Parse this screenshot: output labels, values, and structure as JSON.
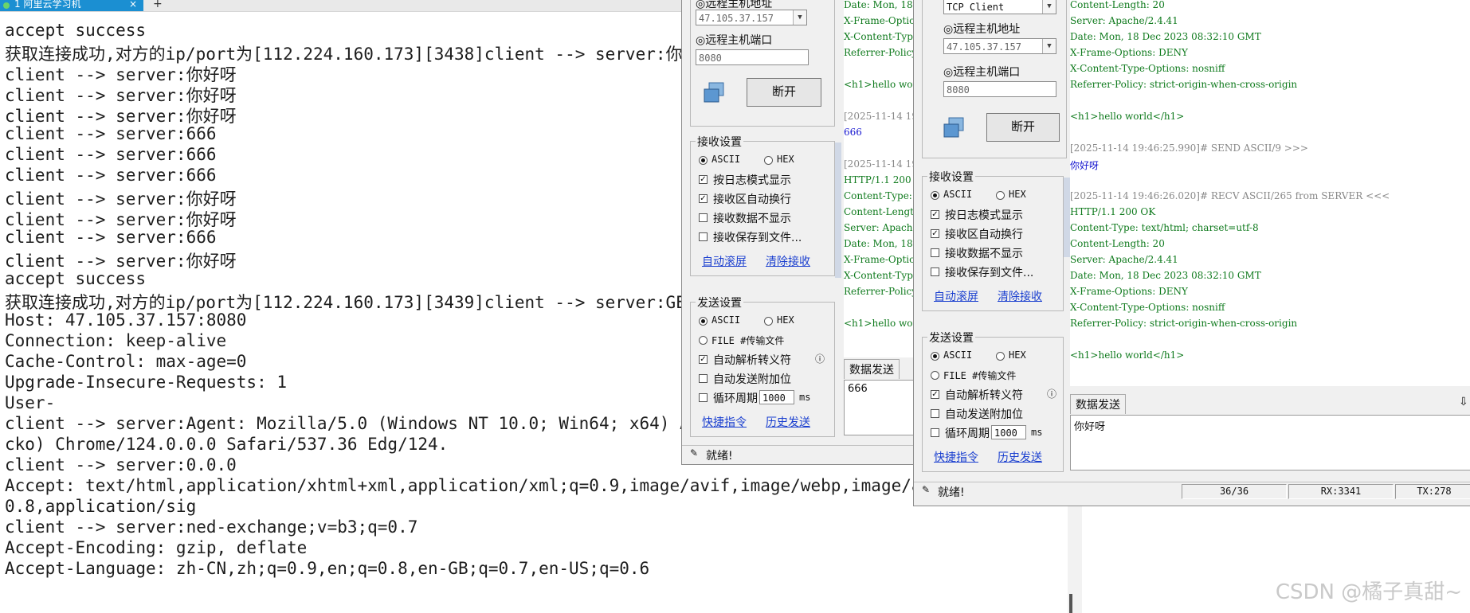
{
  "terminal": {
    "tab_label": "1 阿里云学习机",
    "close_glyph": "×",
    "new_tab_glyph": "+",
    "lines": [
      "accept success",
      "获取连接成功,对方的ip/port为[112.224.160.173][3438]client --> server:你好呀",
      "client --> server:你好呀",
      "client --> server:你好呀",
      "client --> server:你好呀",
      "client --> server:666",
      "client --> server:666",
      "client --> server:666",
      "client --> server:你好呀",
      "client --> server:你好呀",
      "client --> server:666",
      "client --> server:你好呀",
      "accept success",
      "获取连接成功,对方的ip/port为[112.224.160.173][3439]client --> server:GET / HTTP/1.1",
      "Host: 47.105.37.157:8080",
      "Connection: keep-alive",
      "Cache-Control: max-age=0",
      "Upgrade-Insecure-Requests: 1",
      "User-",
      "client --> server:Agent: Mozilla/5.0 (Windows NT 10.0; Win64; x64) AppleWebKit/537.36 (KHTML, like Ge",
      "cko) Chrome/124.0.0.0 Safari/537.36 Edg/124.",
      "client --> server:0.0.0",
      "Accept: text/html,application/xhtml+xml,application/xml;q=0.9,image/avif,image/webp,image/apng,*/*;q=",
      "0.8,application/sig",
      "client --> server:ned-exchange;v=b3;q=0.7",
      "Accept-Encoding: gzip, deflate",
      "Accept-Language: zh-CN,zh;q=0.9,en;q=0.8,en-GB;q=0.7,en-US;q=0.6"
    ]
  },
  "tool1": {
    "remote_host_label": "◎远程主机地址",
    "remote_host_value": "47.105.37.157",
    "remote_port_label": "◎远程主机端口",
    "remote_port_value": "8080",
    "disconnect_label": "断开",
    "recv_group_title": "接收设置",
    "recv_ascii": "ASCII",
    "recv_hex": "HEX",
    "opt_log_mode": "按日志模式显示",
    "opt_auto_wrap": "接收区自动换行",
    "opt_hide_data": "接收数据不显示",
    "opt_save_file": "接收保存到文件...",
    "link_auto_scroll": "自动滚屏",
    "link_clear_recv": "清除接收",
    "send_group_title": "发送设置",
    "send_ascii": "ASCII",
    "send_hex": "HEX",
    "send_file": "FILE #传输文件",
    "opt_escape": "自动解析转义符",
    "opt_append": "自动发送附加位",
    "opt_cycle": "循环周期",
    "cycle_value": "1000",
    "cycle_unit": "ms",
    "link_shortcut": "快捷指令",
    "link_history": "历史发送",
    "send_tab": "数据发送",
    "send_content": "666",
    "status_text": "就绪!",
    "log": [
      {
        "text": "Date: Mon, 18 Dec 2023 08:32:10 GMT",
        "cls": "grn"
      },
      {
        "text": "X-Frame-Options: DENY",
        "cls": "grn"
      },
      {
        "text": "X-Content-Type-Options: nosniff",
        "cls": "grn"
      },
      {
        "text": "Referrer-Policy: strict-origin-when-cross-origin",
        "cls": "grn"
      },
      {
        "text": "",
        "cls": "grn"
      },
      {
        "text": "<h1>hello world</h1>",
        "cls": "grn"
      },
      {
        "text": "",
        "cls": "grn"
      },
      {
        "text": "[2025-11-14 19:46:00.000]# SEND ASCII/3 >>>",
        "cls": "gry"
      },
      {
        "text": "666",
        "cls": "blu"
      },
      {
        "text": "",
        "cls": "grn"
      },
      {
        "text": "[2025-11-14 19:46:00.000]# RECV ASCII/265 from SERVER <<<",
        "cls": "gry"
      },
      {
        "text": "HTTP/1.1 200 OK",
        "cls": "grn"
      },
      {
        "text": "Content-Type: text/html; charset=utf-8",
        "cls": "grn"
      },
      {
        "text": "Content-Length: 20",
        "cls": "grn"
      },
      {
        "text": "Server: Apache/2.4.41",
        "cls": "grn"
      },
      {
        "text": "Date: Mon, 18 Dec 2023 08:32:10 GMT",
        "cls": "grn"
      },
      {
        "text": "X-Frame-Options: DENY",
        "cls": "grn"
      },
      {
        "text": "X-Content-Type-Options: nosniff",
        "cls": "grn"
      },
      {
        "text": "Referrer-Policy: strict-origin-when-cross-origin",
        "cls": "grn"
      },
      {
        "text": "",
        "cls": "grn"
      },
      {
        "text": "<h1>hello world</h1>",
        "cls": "grn"
      }
    ]
  },
  "tool2": {
    "mode_value": "TCP Client",
    "remote_host_label": "◎远程主机地址",
    "remote_host_value": "47.105.37.157",
    "remote_port_label": "◎远程主机端口",
    "remote_port_value": "8080",
    "disconnect_label": "断开",
    "recv_group_title": "接收设置",
    "recv_ascii": "ASCII",
    "recv_hex": "HEX",
    "opt_log_mode": "按日志模式显示",
    "opt_auto_wrap": "接收区自动换行",
    "opt_hide_data": "接收数据不显示",
    "opt_save_file": "接收保存到文件...",
    "link_auto_scroll": "自动滚屏",
    "link_clear_recv": "清除接收",
    "send_group_title": "发送设置",
    "send_ascii": "ASCII",
    "send_hex": "HEX",
    "send_file": "FILE #传输文件",
    "opt_escape": "自动解析转义符",
    "opt_append": "自动发送附加位",
    "opt_cycle": "循环周期",
    "cycle_value": "1000",
    "cycle_unit": "ms",
    "link_shortcut": "快捷指令",
    "link_history": "历史发送",
    "send_tab": "数据发送",
    "send_content": "你好呀",
    "status_text": "就绪!",
    "status_count": "36/36",
    "status_rx": "RX:3341",
    "status_tx": "TX:278",
    "log": [
      {
        "text": "Content-Length: 20",
        "cls": "grn"
      },
      {
        "text": "Server: Apache/2.4.41",
        "cls": "grn"
      },
      {
        "text": "Date: Mon, 18 Dec 2023 08:32:10 GMT",
        "cls": "grn"
      },
      {
        "text": "X-Frame-Options: DENY",
        "cls": "grn"
      },
      {
        "text": "X-Content-Type-Options: nosniff",
        "cls": "grn"
      },
      {
        "text": "Referrer-Policy: strict-origin-when-cross-origin",
        "cls": "grn"
      },
      {
        "text": "",
        "cls": "grn"
      },
      {
        "text": "<h1>hello world</h1>",
        "cls": "grn"
      },
      {
        "text": "",
        "cls": "grn"
      },
      {
        "text": "[2025-11-14 19:46:25.990]# SEND ASCII/9 >>>",
        "cls": "gry"
      },
      {
        "text": "你好呀",
        "cls": "blu"
      },
      {
        "text": "",
        "cls": "grn"
      },
      {
        "text": "[2025-11-14 19:46:26.020]# RECV ASCII/265 from SERVER <<<",
        "cls": "gry"
      },
      {
        "text": "HTTP/1.1 200 OK",
        "cls": "grn"
      },
      {
        "text": "Content-Type: text/html; charset=utf-8",
        "cls": "grn"
      },
      {
        "text": "Content-Length: 20",
        "cls": "grn"
      },
      {
        "text": "Server: Apache/2.4.41",
        "cls": "grn"
      },
      {
        "text": "Date: Mon, 18 Dec 2023 08:32:10 GMT",
        "cls": "grn"
      },
      {
        "text": "X-Frame-Options: DENY",
        "cls": "grn"
      },
      {
        "text": "X-Content-Type-Options: nosniff",
        "cls": "grn"
      },
      {
        "text": "Referrer-Policy: strict-origin-when-cross-origin",
        "cls": "grn"
      },
      {
        "text": "",
        "cls": "grn"
      },
      {
        "text": "<h1>hello world</h1>",
        "cls": "grn"
      }
    ]
  },
  "watermark": "CSDN @橘子真甜~",
  "colors": {
    "tab_active": "#1b8fd2",
    "log_green": "#0f7a1d",
    "log_gray": "#888888",
    "log_blue": "#1717d0",
    "link_blue": "#1a3fcf"
  }
}
